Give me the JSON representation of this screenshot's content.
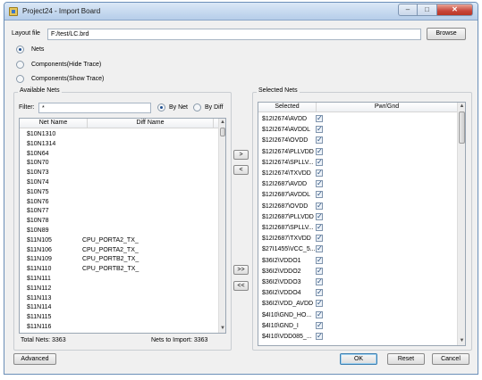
{
  "window": {
    "title": "Project24 - Import Board"
  },
  "layout_file": {
    "label": "Layout file",
    "value": "F:/test/LC.brd",
    "browse_label": "Browse"
  },
  "mode_options": [
    {
      "label": "Nets",
      "selected": true
    },
    {
      "label": "Components(Hide Trace)",
      "selected": false
    },
    {
      "label": "Components(Show Trace)",
      "selected": false
    }
  ],
  "available": {
    "title": "Available Nets",
    "filter_label": "Filter:",
    "filter_value": "*",
    "by_net_label": "By Net",
    "by_diff_label": "By Diff",
    "col_net": "Net Name",
    "col_diff": "Diff Name",
    "rows": [
      {
        "net": "$10N1310",
        "diff": ""
      },
      {
        "net": "$10N1314",
        "diff": ""
      },
      {
        "net": "$10N64",
        "diff": ""
      },
      {
        "net": "$10N70",
        "diff": ""
      },
      {
        "net": "$10N73",
        "diff": ""
      },
      {
        "net": "$10N74",
        "diff": ""
      },
      {
        "net": "$10N75",
        "diff": ""
      },
      {
        "net": "$10N76",
        "diff": ""
      },
      {
        "net": "$10N77",
        "diff": ""
      },
      {
        "net": "$10N78",
        "diff": ""
      },
      {
        "net": "$10N89",
        "diff": ""
      },
      {
        "net": "$11N105",
        "diff": "CPU_PORTA2_TX_"
      },
      {
        "net": "$11N106",
        "diff": "CPU_PORTA2_TX_"
      },
      {
        "net": "$11N109",
        "diff": "CPU_PORTB2_TX_"
      },
      {
        "net": "$11N110",
        "diff": "CPU_PORTB2_TX_"
      },
      {
        "net": "$11N111",
        "diff": ""
      },
      {
        "net": "$11N112",
        "diff": ""
      },
      {
        "net": "$11N113",
        "diff": ""
      },
      {
        "net": "$11N114",
        "diff": ""
      },
      {
        "net": "$11N115",
        "diff": ""
      },
      {
        "net": "$11N116",
        "diff": ""
      }
    ],
    "total_label": "Total Nets: 3363",
    "import_label": "Nets to Import: 3363"
  },
  "transfer": {
    "add": ">",
    "remove": "<",
    "add_all": ">>",
    "remove_all": "<<"
  },
  "selected": {
    "title": "Selected Nets",
    "col_selected": "Selected",
    "col_pwr": "Pwr/Gnd",
    "rows": [
      "$12I2674\\AVDD",
      "$12I2674\\AVDDL",
      "$12I2674\\OVDD",
      "$12I2674\\PLLVDD",
      "$12I2674\\SPLLV...",
      "$12I2674\\TXVDD",
      "$12I2687\\AVDD",
      "$12I2687\\AVDDL",
      "$12I2687\\OVDD",
      "$12I2687\\PLLVDD",
      "$12I2687\\SPLLV...",
      "$12I2687\\TXVDD",
      "$27I1455\\VCC_5...",
      "$36I2\\VDDO1",
      "$36I2\\VDDO2",
      "$36I2\\VDDO3",
      "$36I2\\VDDO4",
      "$36I2\\VDD_AVDD",
      "$4I10\\GND_HO...",
      "$4I10\\GND_I",
      "$4I10\\VDD085_..."
    ]
  },
  "footer": {
    "advanced": "Advanced",
    "ok": "OK",
    "reset": "Reset",
    "cancel": "Cancel"
  }
}
